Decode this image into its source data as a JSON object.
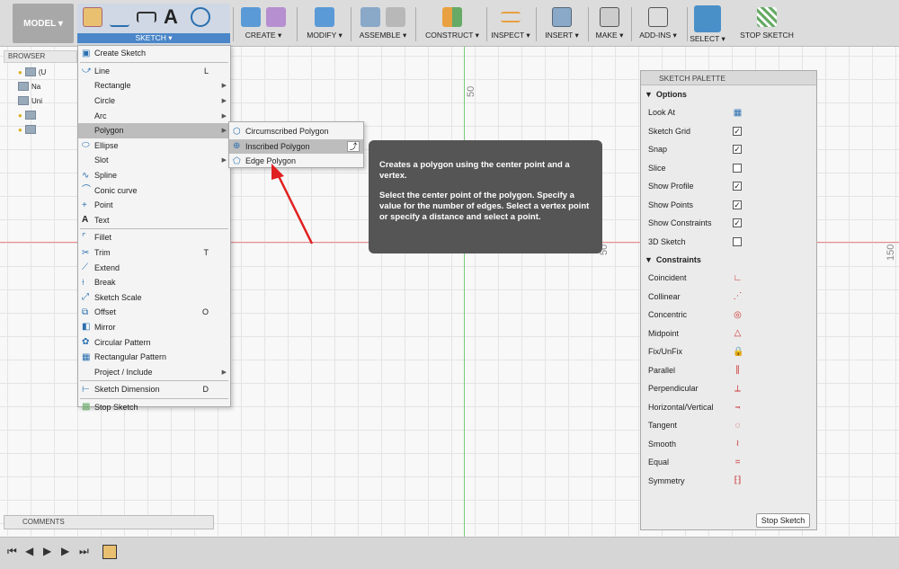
{
  "toolbar": {
    "model_label": "MODEL ▾",
    "sketch_label": "SKETCH ▾",
    "groups": [
      "CREATE ▾",
      "MODIFY ▾",
      "ASSEMBLE ▾",
      "CONSTRUCT ▾",
      "INSPECT ▾",
      "INSERT ▾",
      "MAKE ▾",
      "ADD-INS ▾",
      "SELECT ▾",
      "STOP SKETCH"
    ]
  },
  "browser": {
    "title": "BROWSER",
    "rows": [
      "(U",
      "Na",
      "Uni",
      "",
      ""
    ]
  },
  "comments": "COMMENTS",
  "canvas": {
    "dim_top": "50",
    "dim_mid": "50",
    "dim_right": "150"
  },
  "sketch_menu": {
    "items": [
      {
        "label": "Create Sketch",
        "shortcut": "",
        "arrow": false
      },
      {
        "label": "Line",
        "shortcut": "L",
        "arrow": false
      },
      {
        "label": "Rectangle",
        "shortcut": "",
        "arrow": true
      },
      {
        "label": "Circle",
        "shortcut": "",
        "arrow": true
      },
      {
        "label": "Arc",
        "shortcut": "",
        "arrow": true
      },
      {
        "label": "Polygon",
        "shortcut": "",
        "arrow": true
      },
      {
        "label": "Ellipse",
        "shortcut": "",
        "arrow": false
      },
      {
        "label": "Slot",
        "shortcut": "",
        "arrow": true
      },
      {
        "label": "Spline",
        "shortcut": "",
        "arrow": false
      },
      {
        "label": "Conic curve",
        "shortcut": "",
        "arrow": false
      },
      {
        "label": "Point",
        "shortcut": "",
        "arrow": false
      },
      {
        "label": "Text",
        "shortcut": "",
        "arrow": false
      },
      {
        "label": "Fillet",
        "shortcut": "",
        "arrow": false
      },
      {
        "label": "Trim",
        "shortcut": "T",
        "arrow": false
      },
      {
        "label": "Extend",
        "shortcut": "",
        "arrow": false
      },
      {
        "label": "Break",
        "shortcut": "",
        "arrow": false
      },
      {
        "label": "Sketch Scale",
        "shortcut": "",
        "arrow": false
      },
      {
        "label": "Offset",
        "shortcut": "O",
        "arrow": false
      },
      {
        "label": "Mirror",
        "shortcut": "",
        "arrow": false
      },
      {
        "label": "Circular Pattern",
        "shortcut": "",
        "arrow": false
      },
      {
        "label": "Rectangular Pattern",
        "shortcut": "",
        "arrow": false
      },
      {
        "label": "Project / Include",
        "shortcut": "",
        "arrow": true
      },
      {
        "label": "Sketch Dimension",
        "shortcut": "D",
        "arrow": false
      },
      {
        "label": "Stop Sketch",
        "shortcut": "",
        "arrow": false
      }
    ]
  },
  "polygon_submenu": [
    "Circumscribed Polygon",
    "Inscribed Polygon",
    "Edge Polygon"
  ],
  "tooltip": {
    "line1": "Creates a polygon using the center point and a vertex.",
    "line2": "Select the center point of the polygon. Specify a value for the number of edges. Select a vertex point or specify a distance and select a point."
  },
  "palette": {
    "title": "SKETCH PALETTE",
    "options_label": "Options",
    "options": [
      {
        "label": "Look At",
        "checked": null
      },
      {
        "label": "Sketch Grid",
        "checked": true
      },
      {
        "label": "Snap",
        "checked": true
      },
      {
        "label": "Slice",
        "checked": false
      },
      {
        "label": "Show Profile",
        "checked": true
      },
      {
        "label": "Show Points",
        "checked": true
      },
      {
        "label": "Show Constraints",
        "checked": true
      },
      {
        "label": "3D Sketch",
        "checked": false
      }
    ],
    "constraints_label": "Constraints",
    "constraints": [
      "Coincident",
      "Collinear",
      "Concentric",
      "Midpoint",
      "Fix/UnFix",
      "Parallel",
      "Perpendicular",
      "Horizontal/Vertical",
      "Tangent",
      "Smooth",
      "Equal",
      "Symmetry"
    ],
    "stop_button": "Stop Sketch"
  },
  "colors": {
    "accent": "#4a86c8",
    "tooltip_bg": "#555555",
    "arrow": "#e02020"
  }
}
